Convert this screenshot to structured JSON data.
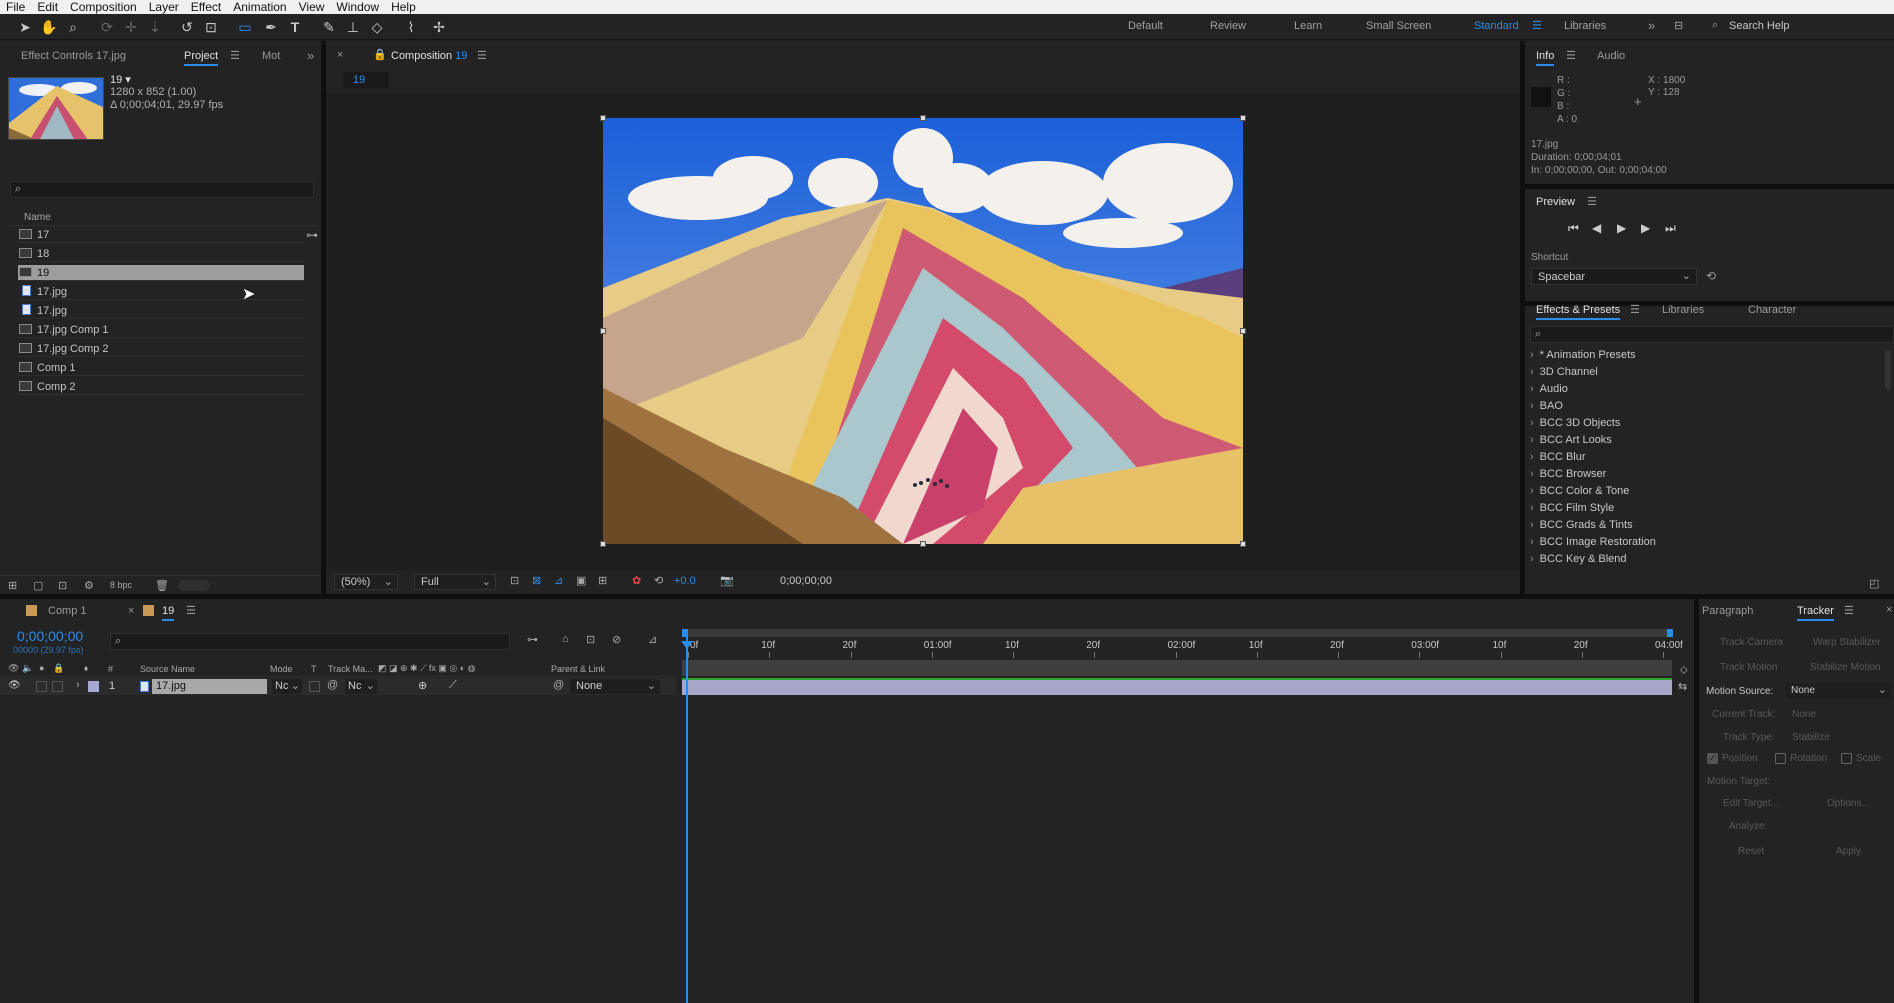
{
  "menu": [
    "File",
    "Edit",
    "Composition",
    "Layer",
    "Effect",
    "Animation",
    "View",
    "Window",
    "Help"
  ],
  "workspaces": {
    "default": "Default",
    "review": "Review",
    "learn": "Learn",
    "small_screen": "Small Screen",
    "standard": "Standard",
    "libraries": "Libraries",
    "search_placeholder": "Search Help"
  },
  "project": {
    "tab_effect_controls": "Effect Controls 17.jpg",
    "tab_project": "Project",
    "tab_mot": "Mot",
    "thumb_name": "19 ▾",
    "thumb_res": "1280 x 852 (1.00)",
    "thumb_dur": "Δ 0;00;04;01, 29.97 fps",
    "col_name": "Name",
    "items": [
      {
        "name": "17",
        "kind": "comp"
      },
      {
        "name": "18",
        "kind": "comp"
      },
      {
        "name": "19",
        "kind": "comp"
      },
      {
        "name": "17.jpg",
        "kind": "file"
      },
      {
        "name": "17.jpg",
        "kind": "file"
      },
      {
        "name": "17.jpg Comp 1",
        "kind": "comp"
      },
      {
        "name": "17.jpg Comp 2",
        "kind": "comp"
      },
      {
        "name": "Comp 1",
        "kind": "comp"
      },
      {
        "name": "Comp 2",
        "kind": "comp"
      }
    ],
    "bpc": "8 bpc"
  },
  "composition": {
    "tab_label": "Composition",
    "tab_comp": "19",
    "subtab": "19",
    "zoom": "(50%)",
    "resolution": "Full",
    "exposure": "+0.0",
    "timecode": "0;00;00;00"
  },
  "info": {
    "tab_info": "Info",
    "tab_audio": "Audio",
    "r": "R :",
    "g": "G :",
    "b": "B :",
    "a": "A : 0",
    "x": "X : 1800",
    "y": "Y : 128",
    "file": "17.jpg",
    "duration": "Duration: 0;00;04;01",
    "inout": "In: 0;00;00;00, Out: 0;00;04;00"
  },
  "preview": {
    "title": "Preview",
    "shortcut_label": "Shortcut",
    "shortcut_value": "Spacebar"
  },
  "effects": {
    "tab_effects": "Effects & Presets",
    "tab_libraries": "Libraries",
    "tab_character": "Character",
    "items": [
      "* Animation Presets",
      "3D Channel",
      "Audio",
      "BAO",
      "BCC 3D Objects",
      "BCC Art Looks",
      "BCC Blur",
      "BCC Browser",
      "BCC Color & Tone",
      "BCC Film Style",
      "BCC Grads & Tints",
      "BCC Image Restoration",
      "BCC Key & Blend"
    ]
  },
  "timeline": {
    "tab_comp1": "Comp 1",
    "tab_19": "19",
    "timecode": "0;00;00;00",
    "timecode_sub": "00000 (29.97 fps)",
    "col_source": "Source Name",
    "col_mode": "Mode",
    "col_t": "T",
    "col_trackmat": "Track Ma...",
    "col_parent": "Parent & Link",
    "layer_num": "1",
    "layer_name": "17.jpg",
    "layer_mode": "Nc",
    "layer_track": "Nc",
    "layer_parent": "None",
    "ruler": [
      "0f",
      "10f",
      "20f",
      "01:00f",
      "10f",
      "20f",
      "02:00f",
      "10f",
      "20f",
      "03:00f",
      "10f",
      "20f",
      "04:00f"
    ]
  },
  "tracker": {
    "tab_paragraph": "Paragraph",
    "tab_tracker": "Tracker",
    "track_camera": "Track Camera",
    "warp_stabilizer": "Warp Stabilizer",
    "track_motion": "Track Motion",
    "stabilize_motion": "Stabilize Motion",
    "motion_source_label": "Motion Source:",
    "motion_source_value": "None",
    "current_track": "Current Track:",
    "current_track_value": "None",
    "track_type": "Track Type:",
    "track_type_value": "Stabilize",
    "position": "Position",
    "rotation": "Rotation",
    "scale": "Scale",
    "motion_target": "Motion Target:",
    "edit_target": "Edit Target...",
    "options": "Options...",
    "analyze": "Analyze:",
    "reset": "Reset",
    "apply": "Apply"
  }
}
